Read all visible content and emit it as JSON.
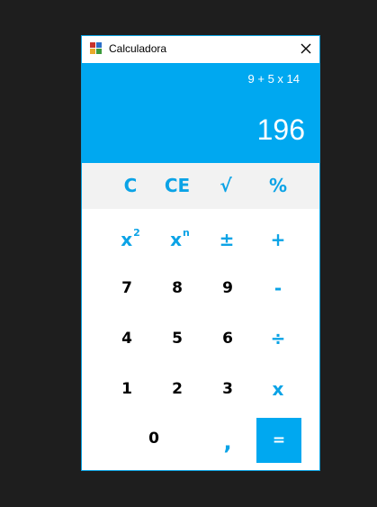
{
  "window": {
    "title": "Calculadora"
  },
  "display": {
    "expression": "9 + 5 x 14",
    "result": "196"
  },
  "function_keys": {
    "clear": "C",
    "clear_entry": "CE",
    "sqrt": "√",
    "percent": "%"
  },
  "keys": {
    "square_base": "x",
    "square_exp": "2",
    "power_base": "x",
    "power_exp": "n",
    "negate": "±",
    "plus": "+",
    "seven": "7",
    "eight": "8",
    "nine": "9",
    "minus": "-",
    "four": "4",
    "five": "5",
    "six": "6",
    "divide": "÷",
    "one": "1",
    "two": "2",
    "three": "3",
    "multiply": "x",
    "zero": "0",
    "decimal": ",",
    "equals": "="
  },
  "colors": {
    "accent": "#00a8f0",
    "key_text_accent": "#0ba3e6",
    "function_row_bg": "#f2f2f2",
    "desktop_bg": "#1e1e1e"
  },
  "icons": {
    "app": "calculator-app-icon",
    "close": "close-icon"
  }
}
